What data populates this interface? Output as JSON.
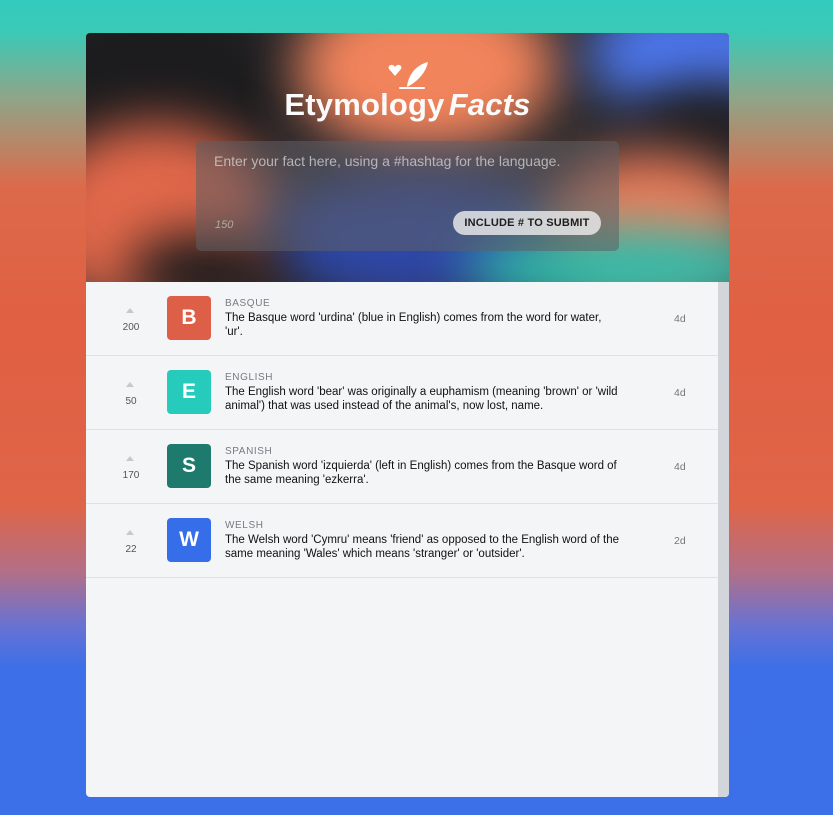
{
  "header": {
    "title_main": "Etymology",
    "title_accent": "Facts",
    "logo_icon": "heart-quill-icon"
  },
  "composer": {
    "placeholder": "Enter your fact here, using a #hashtag for the language.",
    "value": "",
    "char_count": "150",
    "submit_label": "INCLUDE # TO SUBMIT"
  },
  "colors": {
    "basque": "#dd5f48",
    "english": "#27cbbb",
    "spanish": "#1d7a6c",
    "welsh": "#366de8"
  },
  "facts": [
    {
      "votes": "200",
      "letter": "B",
      "language": "BASQUE",
      "text": "The Basque word 'urdina' (blue in English) comes from the word for water, 'ur'.",
      "age": "4d"
    },
    {
      "votes": "50",
      "letter": "E",
      "language": "ENGLISH",
      "text": "The English word 'bear' was originally a euphamism (meaning 'brown' or 'wild animal') that was used instead of the animal's, now lost, name.",
      "age": "4d"
    },
    {
      "votes": "170",
      "letter": "S",
      "language": "SPANISH",
      "text": "The Spanish word 'izquierda' (left in English) comes from the Basque word of the same meaning 'ezkerra'.",
      "age": "4d"
    },
    {
      "votes": "22",
      "letter": "W",
      "language": "WELSH",
      "text": "The Welsh word 'Cymru' means 'friend' as opposed to the English word of the same meaning 'Wales' which means 'stranger' or 'outsider'.",
      "age": "2d"
    }
  ]
}
